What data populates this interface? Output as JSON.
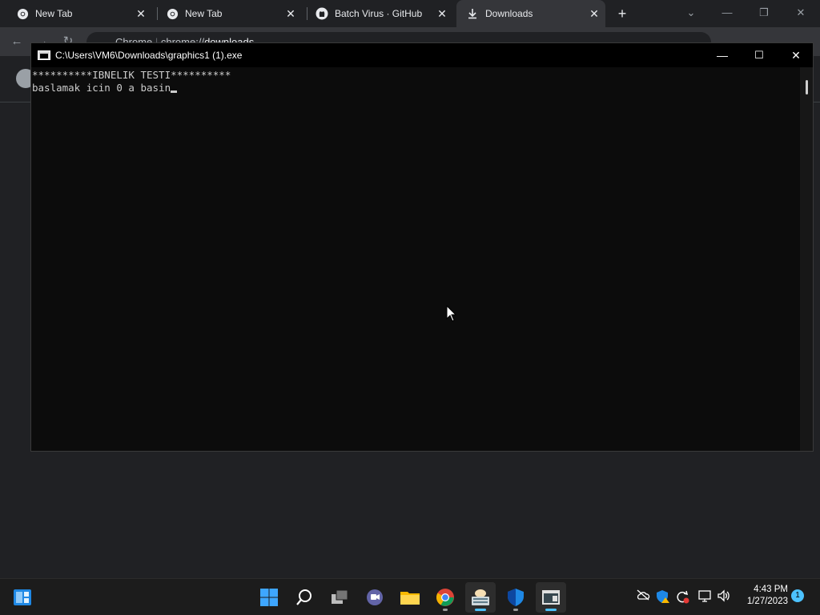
{
  "browser": {
    "tabs": [
      {
        "label": "New Tab",
        "icon": "chrome-icon"
      },
      {
        "label": "New Tab",
        "icon": "chrome-icon"
      },
      {
        "label": "Batch Virus · GitHub",
        "icon": "github-icon"
      },
      {
        "label": "Downloads",
        "icon": "download-icon"
      }
    ],
    "new_tab": "+",
    "omnibox": {
      "scheme_label": "Chrome",
      "url_prefix": "chrome://",
      "url_host": "downloads"
    }
  },
  "console": {
    "title": "C:\\Users\\VM6\\Downloads\\graphics1 (1).exe",
    "lines": [
      "**********IBNELIK TESTI**********",
      "baslamak icin 0 a basin"
    ]
  },
  "taskbar": {
    "apps": [
      "start-icon",
      "search-icon",
      "task-view-icon",
      "chat-icon",
      "file-explorer-icon",
      "chrome-icon",
      "keyboard-app-icon",
      "defender-icon",
      "console-app-icon"
    ],
    "clock": {
      "time": "4:43 PM",
      "date": "1/27/2023"
    },
    "notification_count": "1"
  },
  "colors": {
    "accent": "#4cc2ff",
    "console_bg": "#0c0c0c",
    "console_text": "#cccccc"
  }
}
